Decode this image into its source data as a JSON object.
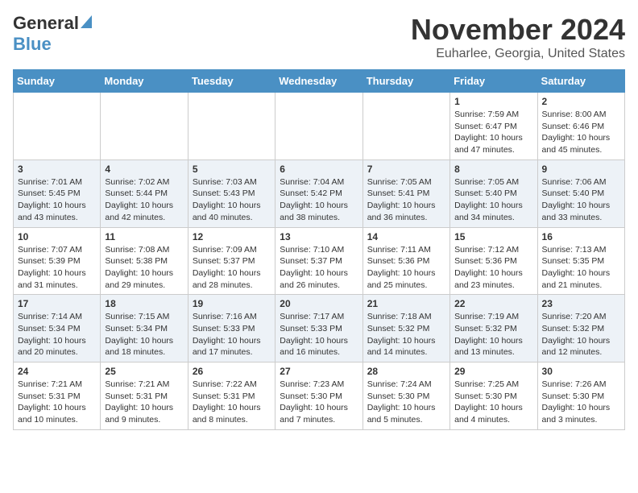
{
  "header": {
    "logo_general": "General",
    "logo_blue": "Blue",
    "month": "November 2024",
    "location": "Euharlee, Georgia, United States"
  },
  "weekdays": [
    "Sunday",
    "Monday",
    "Tuesday",
    "Wednesday",
    "Thursday",
    "Friday",
    "Saturday"
  ],
  "weeks": [
    [
      {
        "day": "",
        "info": ""
      },
      {
        "day": "",
        "info": ""
      },
      {
        "day": "",
        "info": ""
      },
      {
        "day": "",
        "info": ""
      },
      {
        "day": "",
        "info": ""
      },
      {
        "day": "1",
        "info": "Sunrise: 7:59 AM\nSunset: 6:47 PM\nDaylight: 10 hours and 47 minutes."
      },
      {
        "day": "2",
        "info": "Sunrise: 8:00 AM\nSunset: 6:46 PM\nDaylight: 10 hours and 45 minutes."
      }
    ],
    [
      {
        "day": "3",
        "info": "Sunrise: 7:01 AM\nSunset: 5:45 PM\nDaylight: 10 hours and 43 minutes."
      },
      {
        "day": "4",
        "info": "Sunrise: 7:02 AM\nSunset: 5:44 PM\nDaylight: 10 hours and 42 minutes."
      },
      {
        "day": "5",
        "info": "Sunrise: 7:03 AM\nSunset: 5:43 PM\nDaylight: 10 hours and 40 minutes."
      },
      {
        "day": "6",
        "info": "Sunrise: 7:04 AM\nSunset: 5:42 PM\nDaylight: 10 hours and 38 minutes."
      },
      {
        "day": "7",
        "info": "Sunrise: 7:05 AM\nSunset: 5:41 PM\nDaylight: 10 hours and 36 minutes."
      },
      {
        "day": "8",
        "info": "Sunrise: 7:05 AM\nSunset: 5:40 PM\nDaylight: 10 hours and 34 minutes."
      },
      {
        "day": "9",
        "info": "Sunrise: 7:06 AM\nSunset: 5:40 PM\nDaylight: 10 hours and 33 minutes."
      }
    ],
    [
      {
        "day": "10",
        "info": "Sunrise: 7:07 AM\nSunset: 5:39 PM\nDaylight: 10 hours and 31 minutes."
      },
      {
        "day": "11",
        "info": "Sunrise: 7:08 AM\nSunset: 5:38 PM\nDaylight: 10 hours and 29 minutes."
      },
      {
        "day": "12",
        "info": "Sunrise: 7:09 AM\nSunset: 5:37 PM\nDaylight: 10 hours and 28 minutes."
      },
      {
        "day": "13",
        "info": "Sunrise: 7:10 AM\nSunset: 5:37 PM\nDaylight: 10 hours and 26 minutes."
      },
      {
        "day": "14",
        "info": "Sunrise: 7:11 AM\nSunset: 5:36 PM\nDaylight: 10 hours and 25 minutes."
      },
      {
        "day": "15",
        "info": "Sunrise: 7:12 AM\nSunset: 5:36 PM\nDaylight: 10 hours and 23 minutes."
      },
      {
        "day": "16",
        "info": "Sunrise: 7:13 AM\nSunset: 5:35 PM\nDaylight: 10 hours and 21 minutes."
      }
    ],
    [
      {
        "day": "17",
        "info": "Sunrise: 7:14 AM\nSunset: 5:34 PM\nDaylight: 10 hours and 20 minutes."
      },
      {
        "day": "18",
        "info": "Sunrise: 7:15 AM\nSunset: 5:34 PM\nDaylight: 10 hours and 18 minutes."
      },
      {
        "day": "19",
        "info": "Sunrise: 7:16 AM\nSunset: 5:33 PM\nDaylight: 10 hours and 17 minutes."
      },
      {
        "day": "20",
        "info": "Sunrise: 7:17 AM\nSunset: 5:33 PM\nDaylight: 10 hours and 16 minutes."
      },
      {
        "day": "21",
        "info": "Sunrise: 7:18 AM\nSunset: 5:32 PM\nDaylight: 10 hours and 14 minutes."
      },
      {
        "day": "22",
        "info": "Sunrise: 7:19 AM\nSunset: 5:32 PM\nDaylight: 10 hours and 13 minutes."
      },
      {
        "day": "23",
        "info": "Sunrise: 7:20 AM\nSunset: 5:32 PM\nDaylight: 10 hours and 12 minutes."
      }
    ],
    [
      {
        "day": "24",
        "info": "Sunrise: 7:21 AM\nSunset: 5:31 PM\nDaylight: 10 hours and 10 minutes."
      },
      {
        "day": "25",
        "info": "Sunrise: 7:21 AM\nSunset: 5:31 PM\nDaylight: 10 hours and 9 minutes."
      },
      {
        "day": "26",
        "info": "Sunrise: 7:22 AM\nSunset: 5:31 PM\nDaylight: 10 hours and 8 minutes."
      },
      {
        "day": "27",
        "info": "Sunrise: 7:23 AM\nSunset: 5:30 PM\nDaylight: 10 hours and 7 minutes."
      },
      {
        "day": "28",
        "info": "Sunrise: 7:24 AM\nSunset: 5:30 PM\nDaylight: 10 hours and 5 minutes."
      },
      {
        "day": "29",
        "info": "Sunrise: 7:25 AM\nSunset: 5:30 PM\nDaylight: 10 hours and 4 minutes."
      },
      {
        "day": "30",
        "info": "Sunrise: 7:26 AM\nSunset: 5:30 PM\nDaylight: 10 hours and 3 minutes."
      }
    ]
  ]
}
